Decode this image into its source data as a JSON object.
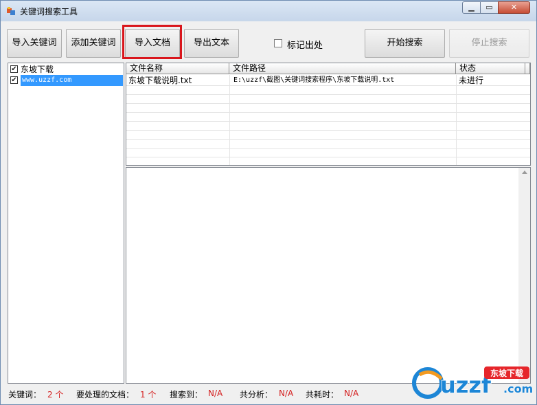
{
  "window": {
    "title": "关键词搜索工具"
  },
  "toolbar": {
    "import_keywords": "导入关键词",
    "add_keyword": "添加关键词",
    "import_docs": "导入文档",
    "export_text": "导出文本",
    "mark_location_label": "标记出处",
    "mark_location_checked": false,
    "start_search": "开始搜索",
    "stop_search": "停止搜索"
  },
  "keywords": [
    {
      "label": "东坡下载",
      "checked": true
    },
    {
      "label": "www.uzzf.com",
      "checked": true
    }
  ],
  "grid": {
    "columns": [
      "文件名称",
      "文件路径",
      "状态"
    ],
    "rows": [
      {
        "name": "东坡下载说明.txt",
        "path": "E:\\uzzf\\截图\\关键词搜索程序\\东坡下载说明.txt",
        "status": "未进行"
      }
    ]
  },
  "statusbar": {
    "keywords_label": "关键词：",
    "keywords_value": "2 个",
    "docs_label": "要处理的文档：",
    "docs_value": "1 个",
    "found_label": "搜索到：",
    "found_value": "N/A",
    "analyzed_label": "共分析：",
    "analyzed_value": "N/A",
    "elapsed_label": "共耗时：",
    "elapsed_value": "N/A"
  },
  "watermark": {
    "logo_text": "uzzf",
    "badge_text": "东坡下载",
    "domain": ".com"
  },
  "colors": {
    "highlight": "#d9161c",
    "selection": "#3399ff",
    "status_value": "#d42020"
  }
}
